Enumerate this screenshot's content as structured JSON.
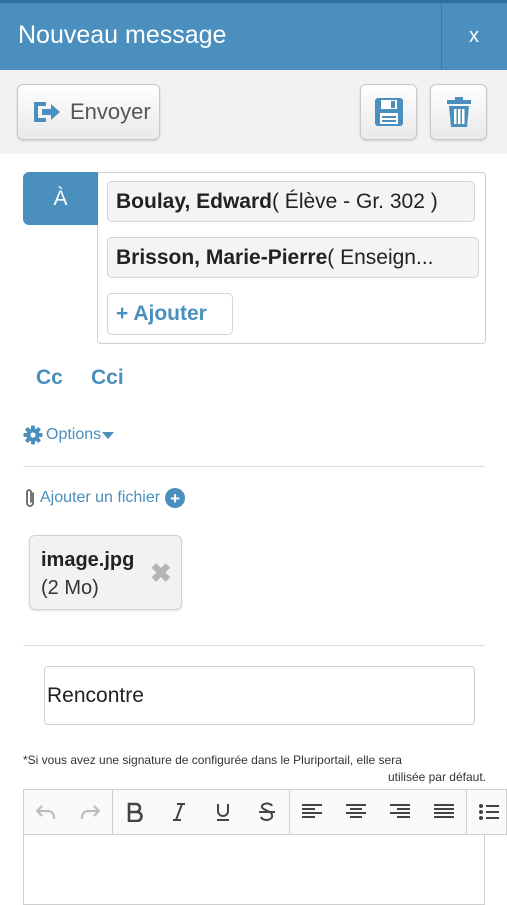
{
  "header": {
    "title": "Nouveau message",
    "close_label": "x"
  },
  "toolbar": {
    "send_label": "Envoyer",
    "send_icon": "send-icon",
    "save_icon": "floppy-disk-icon",
    "delete_icon": "trash-icon"
  },
  "recipients": {
    "to_label": "À",
    "items": [
      {
        "name": "Boulay, Edward",
        "detail": " ( Élève - Gr. 302 )"
      },
      {
        "name": "Brisson, Marie-Pierre",
        "detail": " ( Enseign..."
      }
    ],
    "add_label": "+ Ajouter"
  },
  "cc_label": "Cc",
  "cci_label": "Cci",
  "options_label": "Options",
  "attachments": {
    "add_label": "Ajouter un fichier",
    "files": [
      {
        "name": "image.jpg",
        "size": "(2 Mo)"
      }
    ]
  },
  "subject": {
    "value": "Rencontre"
  },
  "signature_note": {
    "line1": "*Si vous avez une signature de configurée dans le Pluriportail, elle sera",
    "line2": "utilisée par défaut."
  },
  "colors": {
    "accent": "#4a8fbd",
    "header": "#4a8fbd"
  }
}
